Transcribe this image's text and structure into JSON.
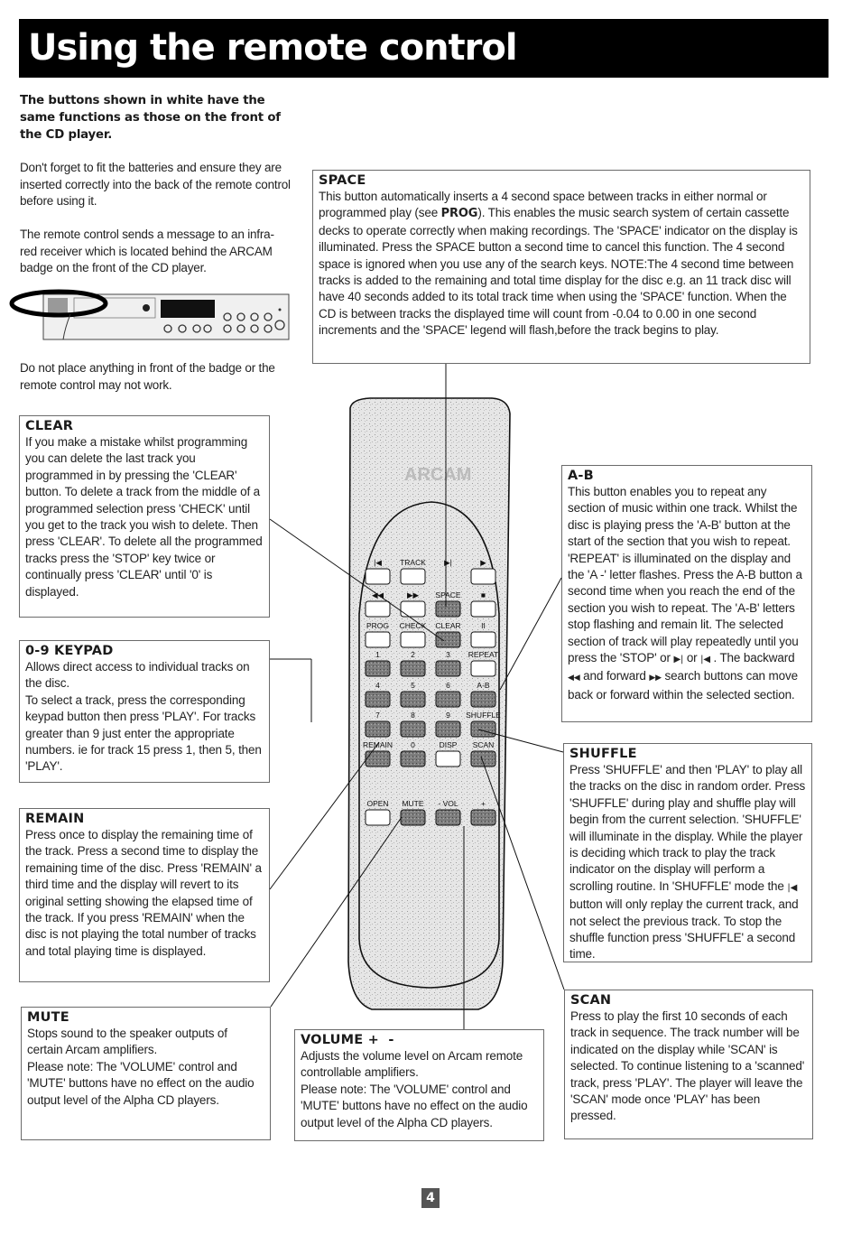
{
  "header": {
    "title": "Using the remote control"
  },
  "intro": {
    "bold_note": "The buttons shown in white have the same functions as those on the front of the CD player.",
    "battery_note": "Don't forget to fit the batteries and ensure they are inserted correctly into the back of the remote control before using it.",
    "receiver_note": "The remote control sends a message to an infra-red receiver which is located behind the ARCAM badge on the front of the CD player.",
    "badge_warning": "Do not place anything in front of the badge or the remote control may not work."
  },
  "sections": {
    "space": {
      "title": "SPACE",
      "text_before": "This button automatically inserts a 4 second space between tracks in either normal or programmed play (see ",
      "bold_ref": "PROG",
      "text_after": "). This enables the music search system of certain cassette decks to operate correctly when making recordings. The 'SPACE' indicator on the display is illuminated.  Press the SPACE button a second time to cancel this function. The 4 second space is ignored when you use any of the search keys.  NOTE:The 4 second time between tracks is added to the remaining and total time display for the disc e.g. an 11 track disc will have 40 seconds added to its total track time when using the 'SPACE' function. When the CD is between tracks the displayed time will count from -0.04 to 0.00 in one second increments and the 'SPACE' legend will flash,before the track begins to play."
    },
    "clear": {
      "title": "CLEAR",
      "text": "If you make a mistake whilst programming you can delete the last track you programmed in by pressing the 'CLEAR' button. To delete a track from the middle of a programmed selection press 'CHECK' until you get to the track you wish to delete. Then press 'CLEAR'. To delete all the programmed tracks press the 'STOP' key twice or continually press 'CLEAR' until '0' is displayed."
    },
    "keypad": {
      "title": "0-9 KEYPAD",
      "text1": "Allows direct access to individual tracks on the disc.",
      "text2": "To select a track, press the corresponding keypad button then press 'PLAY'. For tracks greater than 9 just enter the appropriate numbers. ie for track 15 press 1, then 5, then 'PLAY'."
    },
    "remain": {
      "title": "REMAIN",
      "text": "Press once to display the remaining time of the track.  Press a second time to display the remaining time of the disc.  Press 'REMAIN' a third time and the display will revert to its original setting showing the elapsed time of the track.  If you press 'REMAIN' when the disc is not playing the total number of tracks and total playing time is displayed."
    },
    "mute": {
      "title": "MUTE",
      "text1": "Stops sound to the speaker outputs of certain Arcam amplifiers.",
      "text2": "Please note: The 'VOLUME' control and 'MUTE' buttons have no effect on the audio output level of the Alpha CD players."
    },
    "volume": {
      "title": "VOLUME +  -",
      "text1": "Adjusts the volume level on Arcam remote controllable amplifiers.",
      "text2": "Please note: The 'VOLUME' control and 'MUTE' buttons have no effect on the audio output level of the Alpha CD players."
    },
    "ab": {
      "title": "A-B",
      "text1": "This button enables you to repeat any section of music within one track.  Whilst the disc is playing press the 'A-B' button at the start of the section that you wish to repeat.  'REPEAT' is illuminated on the display and the 'A -' letter flashes. Press the A-B button a second time when you reach the end of the section you wish to repeat. The 'A-B' letters stop flashing and remain lit. The selected section of track will play repeatedly until you press the 'STOP' or ",
      "next_symbol": "▶|",
      "text2": " or ",
      "prev_symbol": "|◀",
      "text3": " . The backward ",
      "rew_symbol": "◀◀",
      "text4": " and forward ",
      "ff_symbol": "▶▶",
      "text5": " search buttons can move back or forward within the selected section."
    },
    "shuffle": {
      "title": "SHUFFLE",
      "text1": "Press 'SHUFFLE' and then 'PLAY' to play all the tracks on the disc in random order. Press 'SHUFFLE' during play and shuffle play will begin from the current selection. 'SHUFFLE' will illuminate in the display. While the player is deciding which track to play the track indicator on the display will perform a scrolling routine. In 'SHUFFLE' mode the ",
      "prev_symbol": "|◀",
      "text2": " button will only replay the current track, and not select the previous track.  To stop the shuffle function press 'SHUFFLE' a second time."
    },
    "scan": {
      "title": "SCAN",
      "text": "Press to play the first 10 seconds of each track in sequence. The track number will be indicated on the display while 'SCAN' is selected.  To continue listening to a 'scanned' track, press 'PLAY'. The player will leave the 'SCAN' mode once 'PLAY' has been pressed."
    }
  },
  "remote": {
    "brand": "ARCAM",
    "track_label": "TRACK",
    "rows": [
      {
        "labels": [
          "|◀",
          "TRACK",
          "▶|",
          "▶"
        ],
        "keys": [
          {
            "name": "prev-track",
            "style": "white"
          },
          {
            "name": "next-track",
            "style": "white"
          },
          {
            "name": "none",
            "style": "none"
          },
          {
            "name": "play",
            "style": "white"
          }
        ]
      },
      {
        "labels": [
          "◀◀",
          "▶▶",
          "SPACE",
          "■"
        ],
        "keys": [
          {
            "name": "rewind",
            "style": "white"
          },
          {
            "name": "fast-forward",
            "style": "white"
          },
          {
            "name": "space",
            "style": "dark"
          },
          {
            "name": "stop",
            "style": "white"
          }
        ]
      },
      {
        "labels": [
          "PROG",
          "CHECK",
          "CLEAR",
          "II"
        ],
        "keys": [
          {
            "name": "prog",
            "style": "white"
          },
          {
            "name": "check",
            "style": "white"
          },
          {
            "name": "clear",
            "style": "dark"
          },
          {
            "name": "pause",
            "style": "white"
          }
        ]
      },
      {
        "labels": [
          "1",
          "2",
          "3",
          "REPEAT"
        ],
        "keys": [
          {
            "name": "1",
            "style": "dark"
          },
          {
            "name": "2",
            "style": "dark"
          },
          {
            "name": "3",
            "style": "dark"
          },
          {
            "name": "repeat",
            "style": "white"
          }
        ]
      },
      {
        "labels": [
          "4",
          "5",
          "6",
          "A-B"
        ],
        "keys": [
          {
            "name": "4",
            "style": "dark"
          },
          {
            "name": "5",
            "style": "dark"
          },
          {
            "name": "6",
            "style": "dark"
          },
          {
            "name": "a-b",
            "style": "dark"
          }
        ]
      },
      {
        "labels": [
          "7",
          "8",
          "9",
          "SHUFFLE"
        ],
        "keys": [
          {
            "name": "7",
            "style": "dark"
          },
          {
            "name": "8",
            "style": "dark"
          },
          {
            "name": "9",
            "style": "dark"
          },
          {
            "name": "shuffle",
            "style": "dark"
          }
        ]
      },
      {
        "labels": [
          "REMAIN",
          "0",
          "DISP",
          "SCAN"
        ],
        "keys": [
          {
            "name": "remain",
            "style": "dark"
          },
          {
            "name": "0",
            "style": "dark"
          },
          {
            "name": "disp",
            "style": "white"
          },
          {
            "name": "scan",
            "style": "dark"
          }
        ]
      },
      {
        "labels": [
          "OPEN",
          "MUTE",
          "-   VOL",
          "+"
        ],
        "keys": [
          {
            "name": "open",
            "style": "white"
          },
          {
            "name": "mute",
            "style": "dark"
          },
          {
            "name": "vol-down",
            "style": "dark"
          },
          {
            "name": "vol-up",
            "style": "dark"
          }
        ]
      }
    ]
  },
  "footer": {
    "page_number": "4"
  },
  "colors": {
    "title_bg": "#000000",
    "title_fg": "#ffffff",
    "dark_key": "#7a7a7a",
    "white_key": "#ffffff"
  }
}
